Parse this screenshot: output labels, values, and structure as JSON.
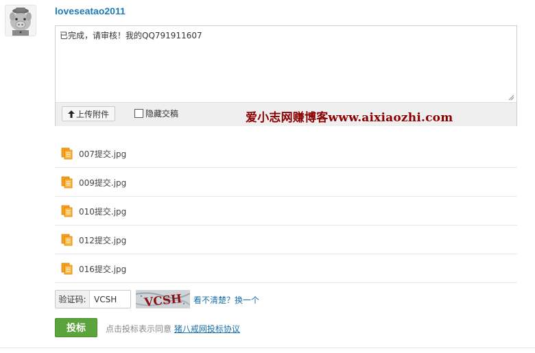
{
  "user": {
    "name": "loveseatao2011",
    "avatar_icon": "pig-avatar-icon"
  },
  "editor": {
    "text": "已完成，请审核！我的QQ791911607",
    "upload_label": "上传附件",
    "upload_icon": "arrow-up-icon",
    "hide_label": "隐藏交稿",
    "hide_checked": false
  },
  "watermark": "爱小志网赚博客www.aixiaozhi.com",
  "attachments": [
    {
      "name": "007提交.jpg",
      "icon": "file-stack-icon"
    },
    {
      "name": "009提交.jpg",
      "icon": "file-stack-icon"
    },
    {
      "name": "010提交.jpg",
      "icon": "file-stack-icon"
    },
    {
      "name": "012提交.jpg",
      "icon": "file-stack-icon"
    },
    {
      "name": "016提交.jpg",
      "icon": "file-stack-icon"
    }
  ],
  "captcha": {
    "label": "验证码:",
    "value": "VCSH",
    "image_text": "VCSH",
    "refresh_label": "看不清楚？换一个"
  },
  "submit": {
    "button_label": "投标",
    "agree_text": "点击投标表示同意",
    "agree_link": "猪八戒网投标协议"
  },
  "colors": {
    "link": "#1b6fa8",
    "username": "#1b7bb3",
    "submit_bg": "#5ba33b",
    "file_icon": "#f08a00",
    "watermark": "#8a0000"
  }
}
